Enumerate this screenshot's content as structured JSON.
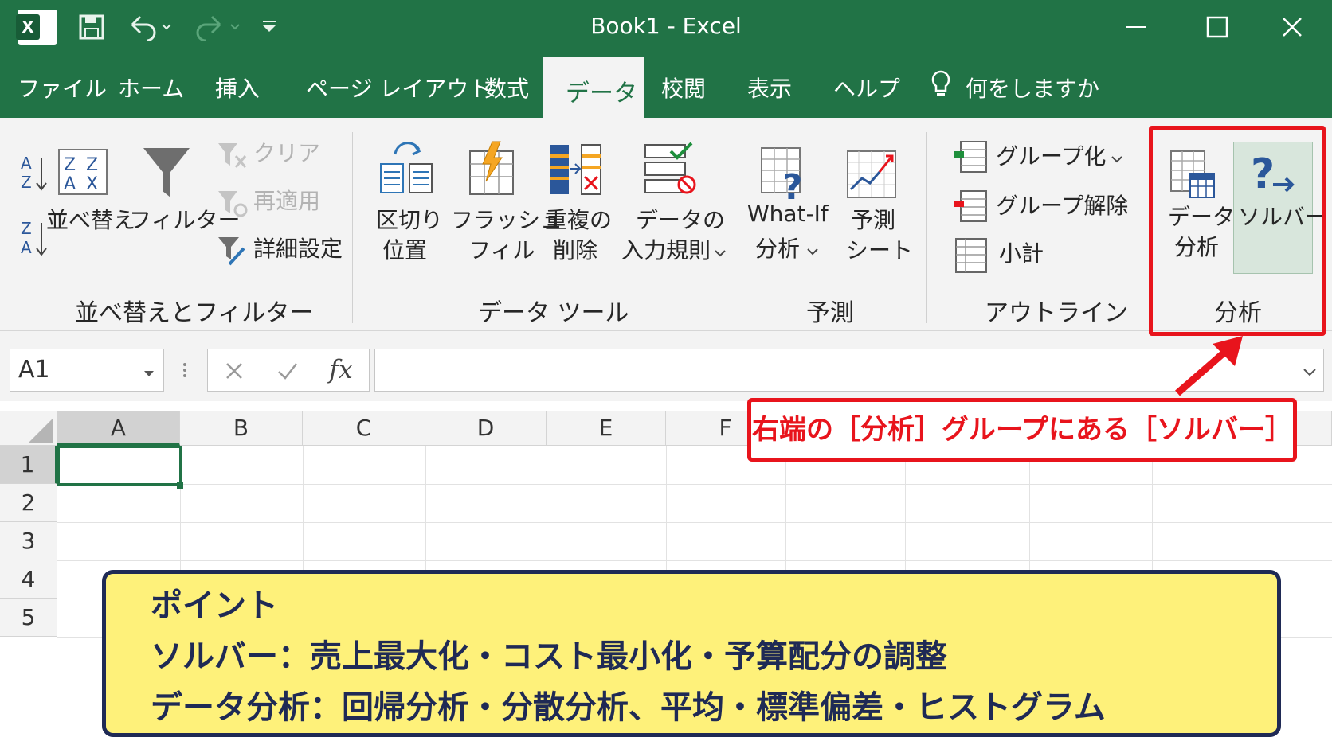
{
  "window": {
    "title": "Book1  -  Excel"
  },
  "tabs": [
    "ファイル",
    "ホーム",
    "挿入",
    "ページ レイアウト",
    "数式",
    "データ",
    "校閲",
    "表示",
    "ヘルプ"
  ],
  "tell_me": "何をしますか",
  "ribbon": {
    "sort_filter": {
      "sort_label": "並べ替え",
      "filter_label": "フィルター",
      "clear_label": "クリア",
      "reapply_label": "再適用",
      "advanced_label": "詳細設定",
      "group_label": "並べ替えとフィルター"
    },
    "data_tools": {
      "text_to_columns": [
        "区切り",
        "位置"
      ],
      "flash_fill": [
        "フラッシュ",
        "フィル"
      ],
      "remove_duplicates": [
        "重複の",
        "削除"
      ],
      "data_validation": [
        "データの",
        "入力規則"
      ],
      "group_label": "データ ツール"
    },
    "forecast": {
      "what_if": [
        "What-If",
        "分析"
      ],
      "forecast_sheet": [
        "予測",
        "シート"
      ],
      "group_label": "予測"
    },
    "outline": {
      "group": "グループ化",
      "ungroup": "グループ解除",
      "subtotal": "小計",
      "group_label": "アウトライン"
    },
    "analysis": {
      "data_analysis": [
        "データ",
        "分析"
      ],
      "solver": "ソルバー",
      "group_label": "分析"
    }
  },
  "formula_bar": {
    "name_box": "A1",
    "fx": "fx"
  },
  "grid": {
    "columns": [
      "A",
      "B",
      "C",
      "D",
      "E",
      "F"
    ],
    "rows": [
      "1",
      "2",
      "3",
      "4",
      "5"
    ]
  },
  "callout": "右端の［分析］グループにある［ソルバー］",
  "point": {
    "title": "ポイント",
    "line1": "ソルバー：売上最大化・コスト最小化・予算配分の調整",
    "line2": "データ分析：回帰分析・分散分析、平均・標準偏差・ヒストグラム"
  },
  "colors": {
    "excel_green": "#217346",
    "callout_red": "#e8141c",
    "point_bg": "#fef17a",
    "point_border": "#1f2a55"
  }
}
